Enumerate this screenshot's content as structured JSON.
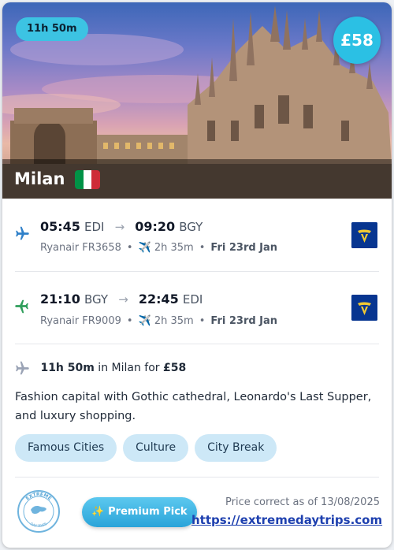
{
  "hero": {
    "duration": "11h 50m",
    "price": "£58",
    "city": "Milan",
    "flag_colors": [
      "#009246",
      "#ffffff",
      "#ce2b37"
    ]
  },
  "outbound": {
    "depart_time": "05:45",
    "depart_code": "EDI",
    "arrive_time": "09:20",
    "arrive_code": "BGY",
    "airline_flight": "Ryanair FR3658",
    "duration": "2h 35m",
    "date": "Fri 23rd Jan",
    "icon_color": "#2f80c9"
  },
  "return": {
    "depart_time": "21:10",
    "depart_code": "BGY",
    "arrive_time": "22:45",
    "arrive_code": "EDI",
    "airline_flight": "Ryanair FR9009",
    "duration": "2h 35m",
    "date": "Fri 23rd Jan",
    "icon_color": "#2f9e5b"
  },
  "stay": {
    "duration": "11h 50m",
    "mid_text": " in Milan for ",
    "price": "£58"
  },
  "description": "Fashion capital with Gothic cathedral, Leonardo's Last Supper, and luxury shopping.",
  "tags": [
    "Famous Cities",
    "Culture",
    "City Break"
  ],
  "footer": {
    "premium_label": "✨ Premium Pick",
    "price_note": "Price correct as of 13/08/2025",
    "site_url": "https://extremedaytrips.com",
    "stamp_top": "EXTREME",
    "stamp_bottom": "DAY TRIPS"
  },
  "colors": {
    "accent": "#2bc0e4",
    "tag_bg": "#cde8f7",
    "ryanair_blue": "#073590",
    "ryanair_yellow": "#f1c933"
  }
}
